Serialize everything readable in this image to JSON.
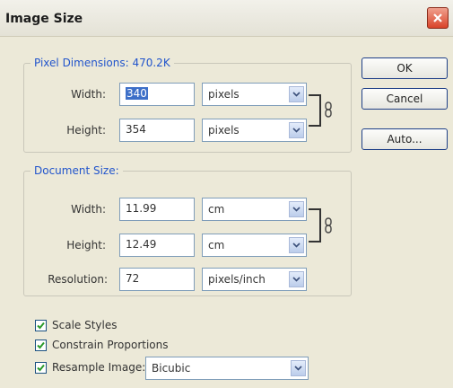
{
  "window": {
    "title": "Image Size"
  },
  "buttons": {
    "ok": "OK",
    "cancel": "Cancel",
    "auto": "Auto..."
  },
  "pixel_dimensions": {
    "legend": "Pixel Dimensions:  470.2K",
    "width_label": "Width:",
    "width_value": "340",
    "width_unit": "pixels",
    "height_label": "Height:",
    "height_value": "354",
    "height_unit": "pixels"
  },
  "document_size": {
    "legend": "Document Size:",
    "width_label": "Width:",
    "width_value": "11.99",
    "width_unit": "cm",
    "height_label": "Height:",
    "height_value": "12.49",
    "height_unit": "cm",
    "resolution_label": "Resolution:",
    "resolution_value": "72",
    "resolution_unit": "pixels/inch"
  },
  "options": {
    "scale_styles": "Scale Styles",
    "constrain_proportions": "Constrain Proportions",
    "resample_image": "Resample Image:",
    "resample_method": "Bicubic"
  },
  "colors": {
    "legend_text": "#2255cc",
    "dialog_bg": "#ece9d8",
    "close_button": "#d9442a",
    "checkbox_check": "#2a9a2a"
  }
}
